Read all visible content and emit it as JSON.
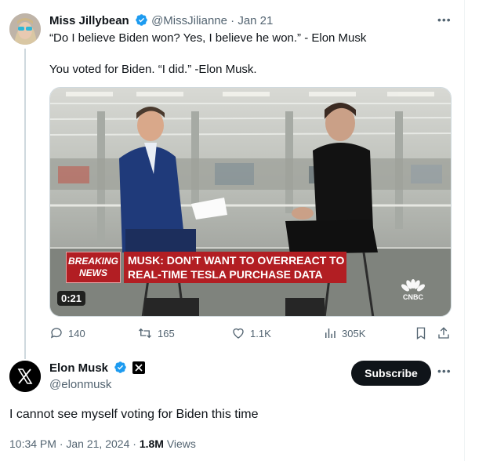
{
  "tweet1": {
    "display_name": "Miss Jillybean",
    "handle": "@MissJilianne",
    "separator": "·",
    "date": "Jan 21",
    "line1": "“Do I believe Biden won? Yes, I believe he won.”  - Elon Musk",
    "line2": "You voted for Biden. “I did.” -Elon Musk.",
    "video": {
      "breaking_top": "BREAKING",
      "breaking_bottom": "NEWS",
      "headline_1": "MUSK: DON’T WANT TO OVERREACT TO",
      "headline_2": "REAL-TIME TESLA PURCHASE DATA",
      "network": "CNBC",
      "duration": "0:21"
    },
    "stats": {
      "replies": "140",
      "reposts": "165",
      "likes": "1.1K",
      "views": "305K"
    }
  },
  "tweet2": {
    "display_name": "Elon Musk",
    "handle": "@elonmusk",
    "subscribe_label": "Subscribe",
    "text": "I cannot see myself voting for Biden this time",
    "time": "10:34 PM",
    "sep": "·",
    "date": "Jan 21, 2024",
    "views_count": "1.8M",
    "views_label": "Views"
  },
  "colors": {
    "verified": "#1d9bf0",
    "text_primary": "#0f1419",
    "text_secondary": "#536471",
    "breaking_red": "#b21e23"
  }
}
